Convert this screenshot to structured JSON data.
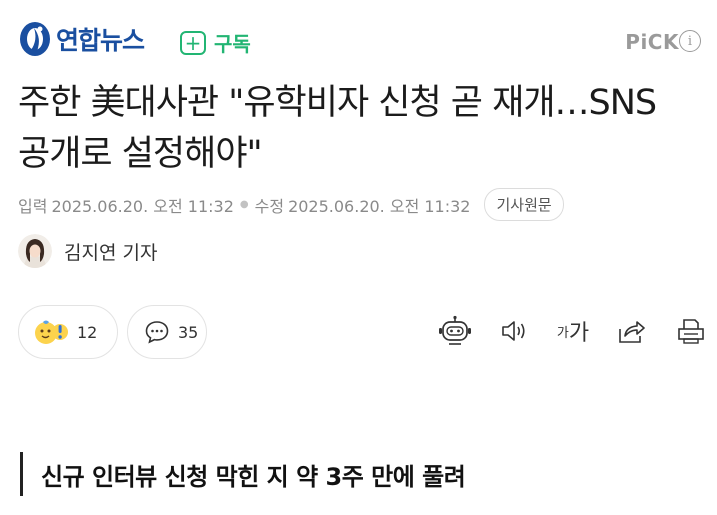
{
  "header": {
    "logo_text": "연합뉴스",
    "subscribe_label": "구독",
    "pick_label": "PiCK",
    "info_glyph": "i"
  },
  "article": {
    "title": "주한 美대사관 \"유학비자 신청 곧 재개…SNS 공개로 설정해야\"",
    "meta": {
      "input_label": "입력",
      "input_datetime": "2025.06.20. 오전 11:32",
      "modified_label": "수정",
      "modified_datetime": "2025.06.20. 오전 11:32",
      "original_button": "기사원문"
    },
    "author": "김지연 기자",
    "reaction_count": "12",
    "comment_count": "35",
    "subheading": "신규 인터뷰 신청 막힌 지 약 3주 만에 풀려"
  },
  "toolbar": {
    "fontsize_small": "가",
    "fontsize_large": "가"
  },
  "icons": [
    "yonhap-logo-icon",
    "plus-icon",
    "info-icon",
    "reaction-emoji-icon",
    "comment-icon",
    "ai-bot-icon",
    "speaker-icon",
    "font-size-icon",
    "share-icon",
    "print-icon"
  ],
  "colors": {
    "brand": "#1a4fa0",
    "subscribe": "#22b573",
    "muted": "#8a8a8a"
  }
}
